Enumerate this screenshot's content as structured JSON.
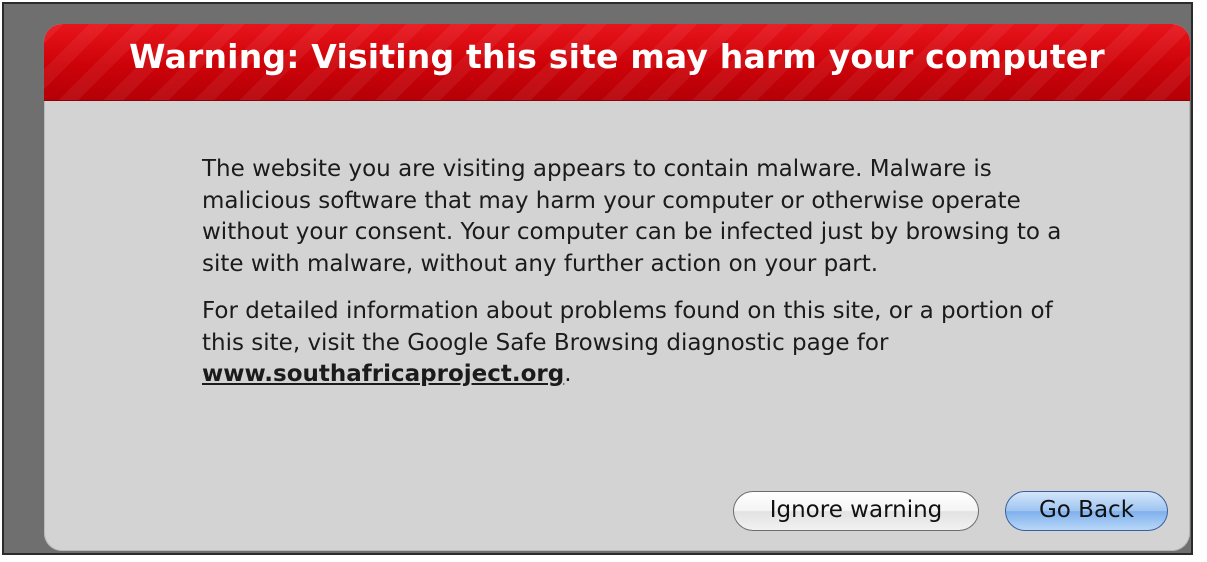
{
  "dialog": {
    "title": "Warning: Visiting this site may harm your computer",
    "paragraph1": "The website you are visiting appears to contain malware. Malware is malicious software that may harm your computer or otherwise operate without your consent. Your computer can be infected just by browsing to a site with malware, without any further action on your part.",
    "paragraph2_prefix": "For detailed information about problems found on this site, or a portion of this site, visit the Google Safe Browsing diagnostic page for ",
    "site_link": "www.southafricaproject.org",
    "paragraph2_suffix": "."
  },
  "buttons": {
    "ignore_label": "Ignore warning",
    "back_label": "Go Back"
  },
  "colors": {
    "header_red": "#cc0208",
    "dialog_gray": "#d3d3d3",
    "default_button_blue": "#9ec4f1"
  }
}
